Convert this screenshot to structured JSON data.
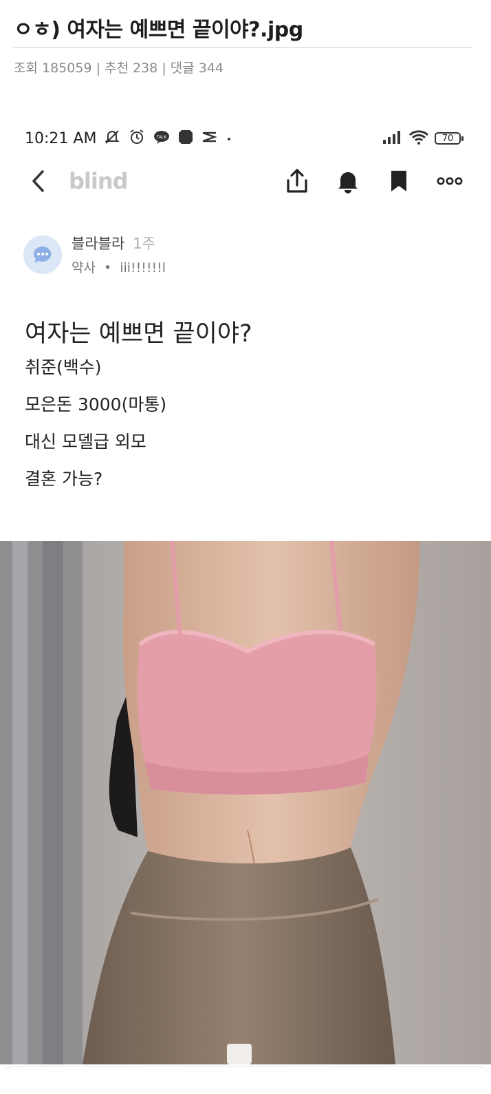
{
  "page": {
    "title": "ㅇㅎ) 여자는 예쁘면 끝이야?.jpg",
    "stats": "조회 185059 | 추천 238 | 댓글 344"
  },
  "status_bar": {
    "time": "10:21 AM",
    "icons": [
      "mute-icon",
      "alarm-icon",
      "kakaotalk-icon",
      "app-icon",
      "capcut-icon",
      "dot-icon"
    ],
    "battery": "70"
  },
  "app_bar": {
    "logo": "blind",
    "actions": [
      "share-icon",
      "bell-icon",
      "bookmark-icon",
      "more-icon"
    ]
  },
  "author": {
    "name": "블라블라",
    "time": "1주",
    "company": "약사",
    "nickname": "iii!!!!!!l"
  },
  "post": {
    "title": "여자는 예쁘면 끝이야?",
    "lines": [
      "취준(백수)",
      "모은돈 3000(마통)",
      "대신 모델급 외모",
      "결혼 가능?"
    ]
  },
  "colors": {
    "accent_gray": "#c9c9c9",
    "avatar_bg": "#dbe7f7",
    "top_pink": "#e9a4ae",
    "leggings": "#8c7866",
    "wall": "#b2aba7"
  }
}
